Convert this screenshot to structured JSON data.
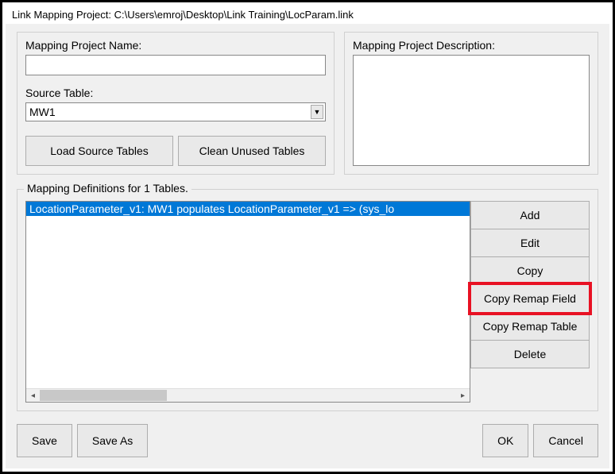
{
  "window_title": "Link Mapping Project: C:\\Users\\emroj\\Desktop\\Link Training\\LocParam.link",
  "left": {
    "name_label": "Mapping Project Name:",
    "name_value": "",
    "source_label": "Source Table:",
    "source_value": "MW1",
    "btn_load": "Load Source Tables",
    "btn_clean": "Clean Unused Tables"
  },
  "right": {
    "desc_label": "Mapping Project Description:",
    "desc_value": ""
  },
  "definitions": {
    "group_title": "Mapping Definitions for 1 Tables.",
    "items": [
      "LocationParameter_v1: MW1 populates LocationParameter_v1 => (sys_lo"
    ],
    "buttons": {
      "add": "Add",
      "edit": "Edit",
      "copy": "Copy",
      "copy_remap_field": "Copy Remap Field",
      "copy_remap_table": "Copy Remap Table",
      "delete": "Delete"
    }
  },
  "bottom": {
    "save": "Save",
    "save_as": "Save As",
    "ok": "OK",
    "cancel": "Cancel"
  }
}
